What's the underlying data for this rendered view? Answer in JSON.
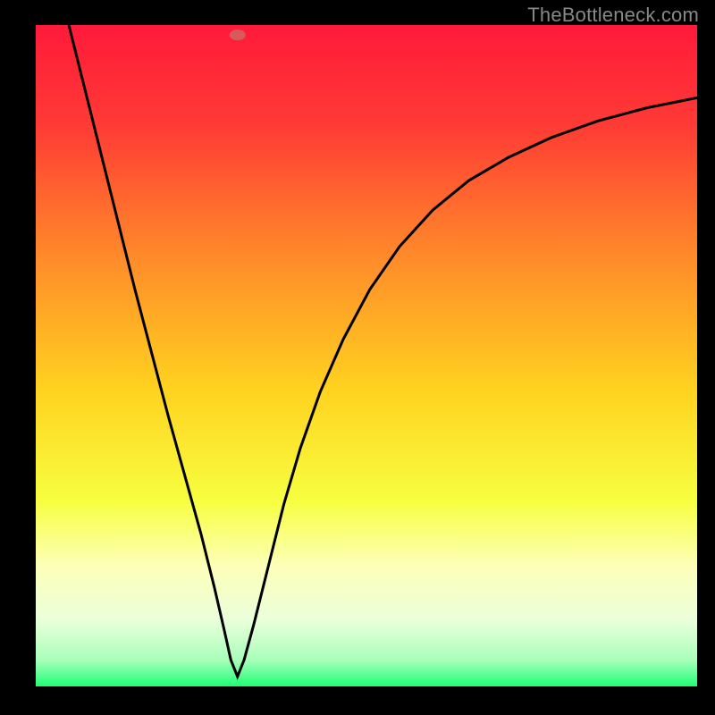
{
  "watermark": "TheBottleneck.com",
  "chart_data": {
    "type": "line",
    "title": "",
    "xlabel": "",
    "ylabel": "",
    "xlim": [
      0,
      1
    ],
    "ylim": [
      0,
      1
    ],
    "gradient_stops": [
      {
        "offset": 0.0,
        "color": "#ff1a3a"
      },
      {
        "offset": 0.15,
        "color": "#ff3a35"
      },
      {
        "offset": 0.35,
        "color": "#ff8a2a"
      },
      {
        "offset": 0.55,
        "color": "#ffd21f"
      },
      {
        "offset": 0.72,
        "color": "#f7ff40"
      },
      {
        "offset": 0.82,
        "color": "#fdffba"
      },
      {
        "offset": 0.9,
        "color": "#eaffda"
      },
      {
        "offset": 0.96,
        "color": "#a8ffba"
      },
      {
        "offset": 1.0,
        "color": "#1eff74"
      }
    ],
    "marker": {
      "x": 0.305,
      "y": 0.985,
      "color": "#d95a5a"
    },
    "series": [
      {
        "name": "curve",
        "points": [
          {
            "x": 0.05,
            "y": 1.0
          },
          {
            "x": 0.075,
            "y": 0.9
          },
          {
            "x": 0.1,
            "y": 0.8
          },
          {
            "x": 0.125,
            "y": 0.7
          },
          {
            "x": 0.15,
            "y": 0.6
          },
          {
            "x": 0.175,
            "y": 0.505
          },
          {
            "x": 0.2,
            "y": 0.41
          },
          {
            "x": 0.225,
            "y": 0.32
          },
          {
            "x": 0.25,
            "y": 0.23
          },
          {
            "x": 0.27,
            "y": 0.15
          },
          {
            "x": 0.285,
            "y": 0.085
          },
          {
            "x": 0.295,
            "y": 0.04
          },
          {
            "x": 0.305,
            "y": 0.015
          },
          {
            "x": 0.315,
            "y": 0.04
          },
          {
            "x": 0.33,
            "y": 0.095
          },
          {
            "x": 0.35,
            "y": 0.175
          },
          {
            "x": 0.375,
            "y": 0.275
          },
          {
            "x": 0.4,
            "y": 0.36
          },
          {
            "x": 0.43,
            "y": 0.445
          },
          {
            "x": 0.465,
            "y": 0.525
          },
          {
            "x": 0.505,
            "y": 0.6
          },
          {
            "x": 0.55,
            "y": 0.665
          },
          {
            "x": 0.6,
            "y": 0.72
          },
          {
            "x": 0.655,
            "y": 0.765
          },
          {
            "x": 0.715,
            "y": 0.8
          },
          {
            "x": 0.78,
            "y": 0.83
          },
          {
            "x": 0.85,
            "y": 0.855
          },
          {
            "x": 0.925,
            "y": 0.875
          },
          {
            "x": 1.0,
            "y": 0.89
          }
        ]
      }
    ]
  }
}
